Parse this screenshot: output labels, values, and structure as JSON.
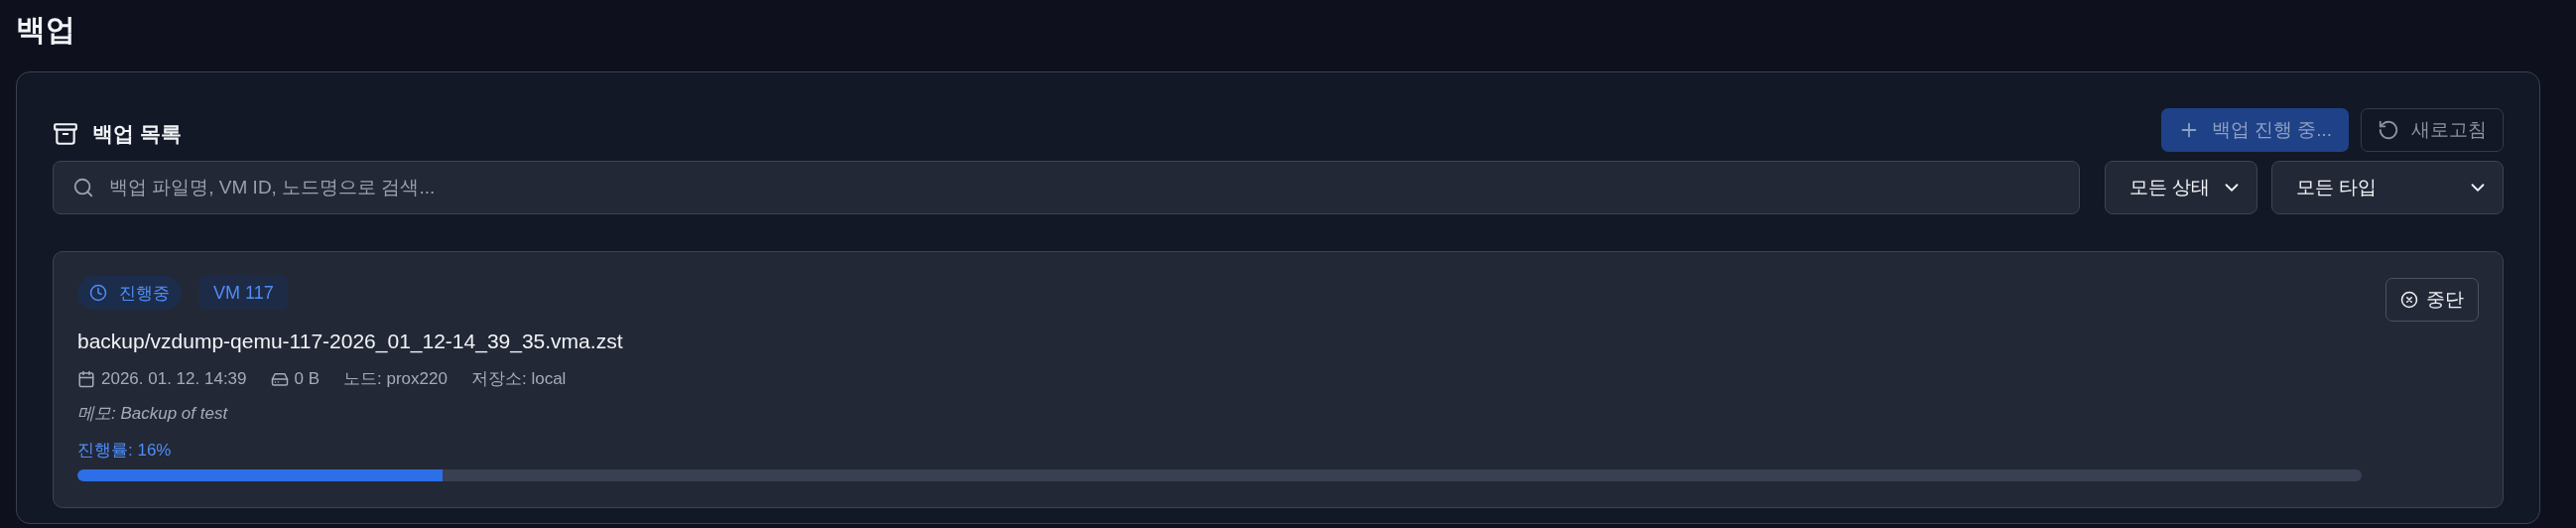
{
  "page_title": "백업",
  "panel": {
    "title": "백업 목록",
    "actions": [
      {
        "kind": "primary",
        "label": "백업 진행 중...",
        "disabled": true
      },
      {
        "kind": "refresh",
        "label": "새로고침",
        "disabled": true
      }
    ],
    "search": {
      "placeholder": "백업 파일명, VM ID, 노드명으로 검색..."
    },
    "filters": [
      {
        "value": "모든 상태"
      },
      {
        "value": "모든 타입"
      }
    ],
    "backups": [
      {
        "status": "진행중",
        "vm": "VM 117",
        "filename": "backup/vzdump-qemu-117-2026_01_12-14_39_35.vma.zst",
        "date": "2026. 01. 12. 14:39",
        "size": "0 B",
        "node": "노드: prox220",
        "storage": "저장소: local",
        "memo": "메모: Backup of test",
        "progress_label": "진행률: 16%",
        "level": 0.16,
        "stop_label": "중단"
      }
    ]
  }
}
